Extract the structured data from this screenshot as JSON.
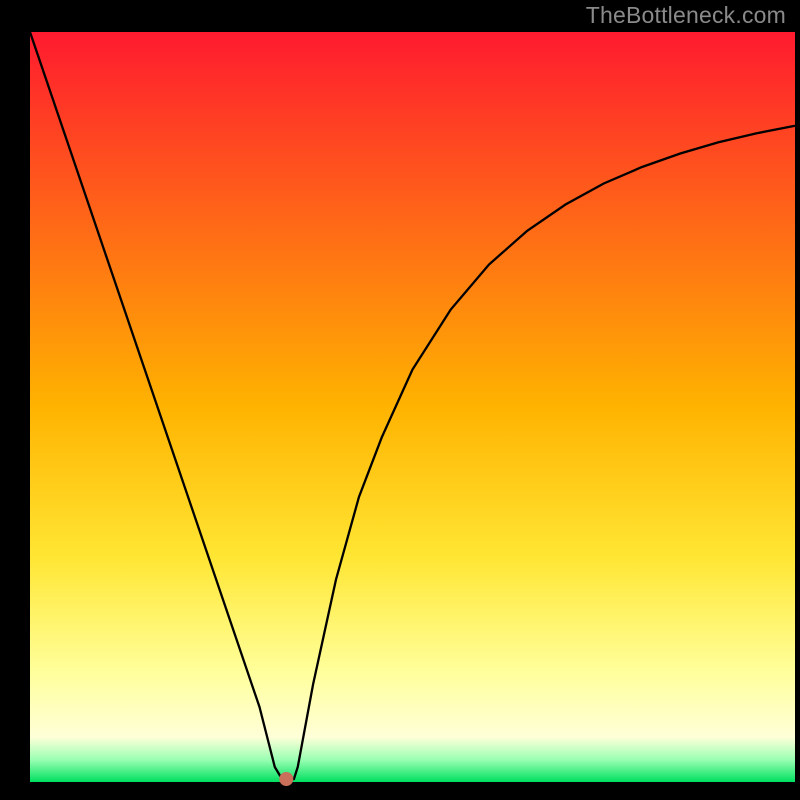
{
  "watermark": "TheBottleneck.com",
  "chart_data": {
    "type": "line",
    "title": "",
    "xlabel": "",
    "ylabel": "",
    "xlim": [
      0,
      100
    ],
    "ylim": [
      0,
      100
    ],
    "grid": false,
    "legend": false,
    "background_gradient": {
      "stops": [
        {
          "offset": 0.0,
          "color": "#ff1a2f"
        },
        {
          "offset": 0.5,
          "color": "#ffb300"
        },
        {
          "offset": 0.7,
          "color": "#ffe633"
        },
        {
          "offset": 0.85,
          "color": "#ffff99"
        },
        {
          "offset": 0.94,
          "color": "#ffffd8"
        },
        {
          "offset": 0.97,
          "color": "#9bffb3"
        },
        {
          "offset": 1.0,
          "color": "#00e060"
        }
      ]
    },
    "minimum_marker": {
      "x": 33.5,
      "y": 0.4,
      "color": "#c96f5a",
      "radius_px": 7
    },
    "series": [
      {
        "name": "bottleneck-curve",
        "color": "#000000",
        "x": [
          0,
          2,
          4,
          6,
          8,
          10,
          12,
          14,
          16,
          18,
          20,
          22,
          24,
          26,
          28,
          30,
          31,
          32,
          33,
          34,
          34.5,
          35,
          37,
          40,
          43,
          46,
          50,
          55,
          60,
          65,
          70,
          75,
          80,
          85,
          90,
          95,
          100
        ],
        "y": [
          100,
          94,
          88,
          82,
          76,
          70,
          64,
          58,
          52,
          46,
          40,
          34,
          28,
          22,
          16,
          10,
          6,
          2,
          0.3,
          0.3,
          0.4,
          2,
          13,
          27,
          38,
          46,
          55,
          63,
          69,
          73.5,
          77,
          79.8,
          82,
          83.8,
          85.3,
          86.5,
          87.5
        ]
      }
    ]
  }
}
